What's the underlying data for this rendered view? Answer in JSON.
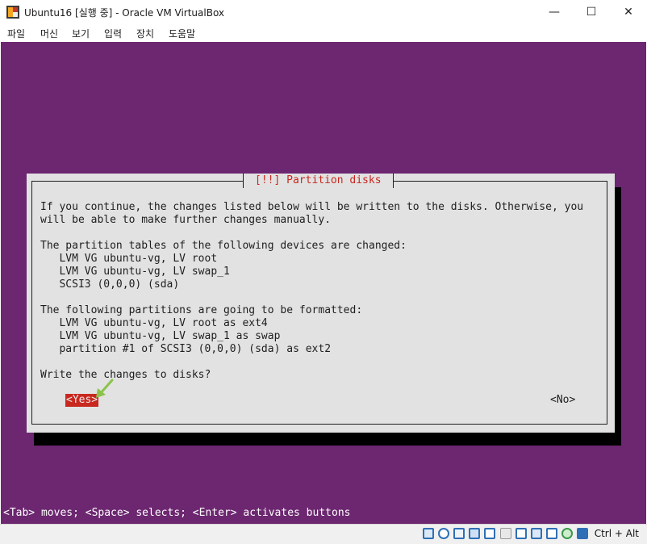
{
  "window": {
    "title": "Ubuntu16 [실행 중] - Oracle VM VirtualBox",
    "minimize": "—",
    "maximize": "☐",
    "close": "✕"
  },
  "menu": [
    "파일",
    "머신",
    "보기",
    "입력",
    "장치",
    "도움말"
  ],
  "dialog": {
    "title": "[!!] Partition disks",
    "lines": [
      "If you continue, the changes listed below will be written to the disks. Otherwise, you",
      "will be able to make further changes manually.",
      "",
      "The partition tables of the following devices are changed:",
      "   LVM VG ubuntu-vg, LV root",
      "   LVM VG ubuntu-vg, LV swap_1",
      "   SCSI3 (0,0,0) (sda)",
      "",
      "The following partitions are going to be formatted:",
      "   LVM VG ubuntu-vg, LV root as ext4",
      "   LVM VG ubuntu-vg, LV swap_1 as swap",
      "   partition #1 of SCSI3 (0,0,0) (sda) as ext2",
      "",
      "Write the changes to disks?"
    ],
    "yes": "<Yes>",
    "no": "<No>"
  },
  "helpline": "<Tab> moves; <Space> selects; <Enter> activates buttons",
  "statusbar": {
    "icons": [
      "hard-disk-icon",
      "optical-drive-icon",
      "audio-icon",
      "network-icon",
      "usb-icon",
      "shared-folder-icon",
      "display-icon",
      "video-capture-icon",
      "cpu-virtualization-icon",
      "mouse-integration-icon",
      "keyboard-icon"
    ],
    "host_key": "Ctrl + Alt",
    "colors": {
      "accent": "#2f6fb5",
      "arrow": "#8bc34a",
      "vm_bg": "#6c2770",
      "highlight": "#c8281e"
    }
  }
}
